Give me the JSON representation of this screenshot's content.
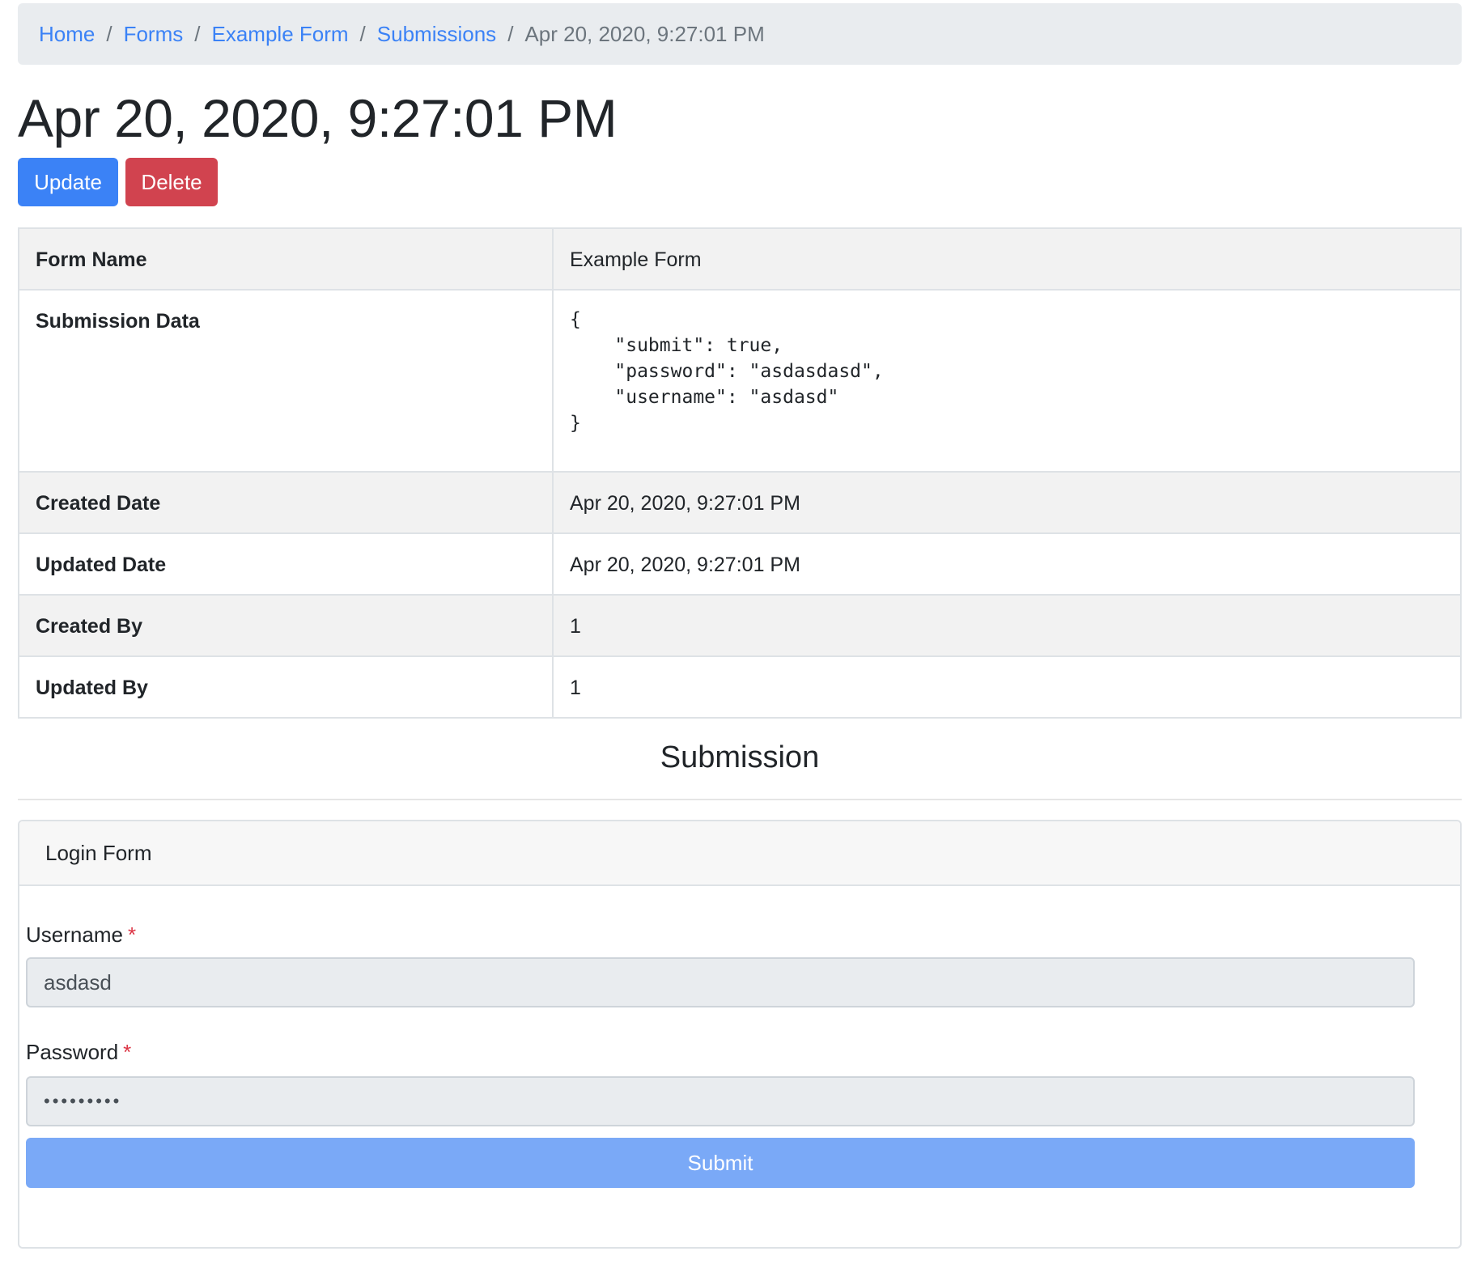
{
  "breadcrumb": {
    "items": [
      "Home",
      "Forms",
      "Example Form",
      "Submissions"
    ],
    "separator": "/",
    "current": "Apr 20, 2020, 9:27:01 PM"
  },
  "page": {
    "title": "Apr 20, 2020, 9:27:01 PM"
  },
  "actions": {
    "update_label": "Update",
    "delete_label": "Delete"
  },
  "details": {
    "rows": [
      {
        "label": "Form Name",
        "value": "Example Form"
      },
      {
        "label": "Submission Data",
        "value": "{\n    \"submit\": true,\n    \"password\": \"asdasdasd\",\n    \"username\": \"asdasd\"\n}"
      },
      {
        "label": "Created Date",
        "value": "Apr 20, 2020, 9:27:01 PM"
      },
      {
        "label": "Updated Date",
        "value": "Apr 20, 2020, 9:27:01 PM"
      },
      {
        "label": "Created By",
        "value": "1"
      },
      {
        "label": "Updated By",
        "value": "1"
      }
    ]
  },
  "submission": {
    "heading": "Submission",
    "form_title": "Login Form",
    "required_marker": "*",
    "username": {
      "label": "Username",
      "value": "asdasd"
    },
    "password": {
      "label": "Password",
      "masked_value": "•••••••••"
    },
    "submit_label": "Submit"
  },
  "colors": {
    "link": "#3b82f6",
    "primary": "#3b82f6",
    "danger": "#d1434f",
    "submit_disabled": "#7aa9f7",
    "required": "#dc3545"
  }
}
